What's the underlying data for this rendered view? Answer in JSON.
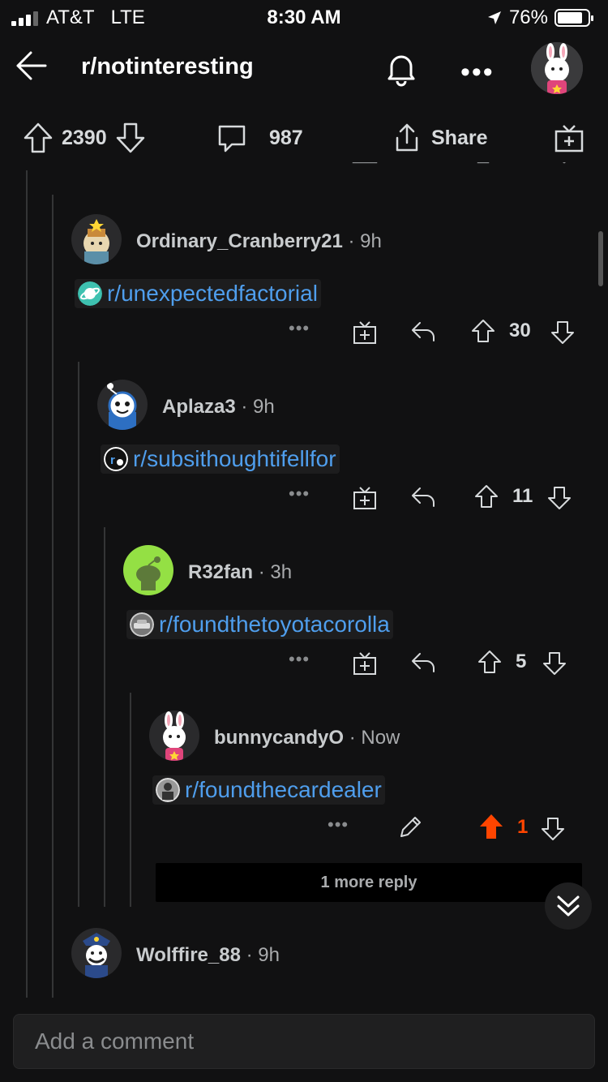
{
  "status_bar": {
    "carrier": "AT&T",
    "network": "LTE",
    "time": "8:30 AM",
    "battery": "76%",
    "battery_level": 0.76,
    "location_icon": "location-arrow-icon"
  },
  "header": {
    "title": "r/notinteresting",
    "back_icon": "back-arrow-icon",
    "bell_icon": "bell-icon",
    "more_icon": "more-horizontal-icon"
  },
  "post_actions": {
    "upvotes": "2390",
    "comments": "987",
    "share_label": "Share"
  },
  "comments": [
    {
      "username": "Ordinary_Cranberry21",
      "time": "9h",
      "link": "r/unexpectedfactorial",
      "votes": "30"
    },
    {
      "username": "Aplaza3",
      "time": "9h",
      "link": "r/subsithoughtifellfor",
      "votes": "11"
    },
    {
      "username": "R32fan",
      "time": "3h",
      "link": "r/foundthetoyotacorolla",
      "votes": "5"
    },
    {
      "username": "bunnycandyO",
      "time": "Now",
      "link": "r/foundthecardealer",
      "votes": "1",
      "upvoted": true
    },
    {
      "username": "Wolffire_88",
      "time": "9h"
    }
  ],
  "more_replies_label": "1 more reply",
  "composer": {
    "placeholder": "Add a comment"
  },
  "colors": {
    "background": "#111112",
    "link": "#4f9eed",
    "upvote_active": "#ff4500",
    "meta_text": "#a9abad"
  }
}
